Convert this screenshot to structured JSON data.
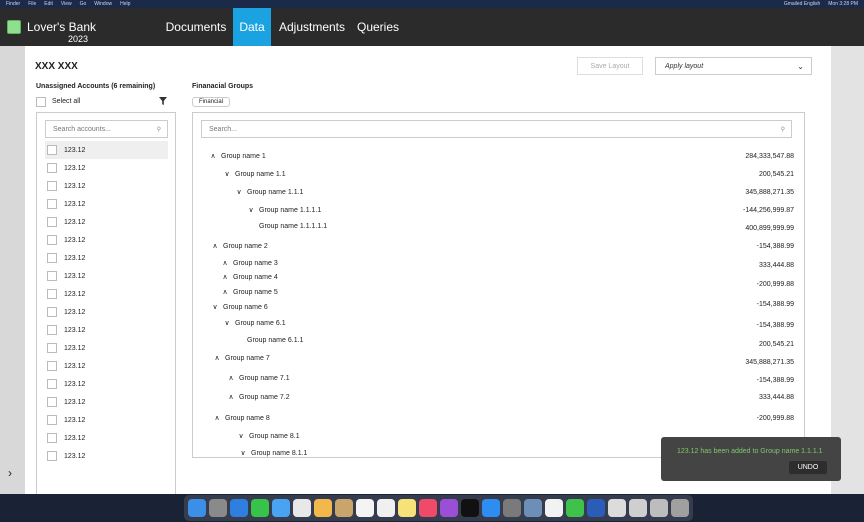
{
  "macbar": {
    "items": [
      "Finder",
      "File",
      "Edit",
      "View",
      "Go",
      "Window",
      "Help"
    ],
    "status_text": "Gmailed English",
    "clock": "Mon 3:28 PM"
  },
  "app": {
    "brand_name": "Lover's Bank",
    "brand_year": "2023",
    "nav": [
      "Documents",
      "Data",
      "Adjustments",
      "Queries"
    ],
    "active_tab": "Data",
    "accent_color": "#1aa3e0"
  },
  "page": {
    "title": "XXX XXX",
    "save_layout_label": "Save Layout",
    "apply_layout_placeholder": "Apply layout"
  },
  "accounts": {
    "title": "Unassigned Accounts (6 remaining)",
    "select_all_label": "Select all",
    "search_placeholder": "Search accounts...",
    "items": [
      "123.12",
      "123.12",
      "123.12",
      "123.12",
      "123.12",
      "123.12",
      "123.12",
      "123.12",
      "123.12",
      "123.12",
      "123.12",
      "123.12",
      "123.12",
      "123.12",
      "123.12",
      "123.12",
      "123.12",
      "123.12"
    ]
  },
  "groups": {
    "title": "Finanacial Groups",
    "tag": "Financial",
    "search_placeholder": "Search...",
    "rows": [
      {
        "name": "Group name 1",
        "value": "284,333,547.88",
        "chevron": "up"
      },
      {
        "name": "Group name 1.1",
        "value": "200,545.21",
        "chevron": "down"
      },
      {
        "name": "Group name 1.1.1",
        "value": "345,888,271.35",
        "chevron": "down"
      },
      {
        "name": "Group name 1.1.1.1",
        "value": "-144,256,999.87",
        "chevron": "down"
      },
      {
        "name": "Group name 1.1.1.1.1",
        "value": "400,899,999.99",
        "chevron": ""
      },
      {
        "name": "Group name 2",
        "value": "-154,388.99",
        "chevron": "up"
      },
      {
        "name": "Group name 3",
        "value": "333,444.88",
        "chevron": "up"
      },
      {
        "name": "Group name 4",
        "value": "-200,999.88",
        "chevron": "up"
      },
      {
        "name": "Group name 5",
        "value": "",
        "chevron": "up"
      },
      {
        "name": "Group name 6",
        "value": "-154,388.99",
        "chevron": "down"
      },
      {
        "name": "Group name 6.1",
        "value": "-154,388.99",
        "chevron": "down"
      },
      {
        "name": "Group name 6.1.1",
        "value": "200,545.21",
        "chevron": ""
      },
      {
        "name": "Group name 7",
        "value": "345,888,271.35",
        "chevron": "up"
      },
      {
        "name": "Group name 7.1",
        "value": "-154,388.99",
        "chevron": "up"
      },
      {
        "name": "Group name 7.2",
        "value": "333,444.88",
        "chevron": "up"
      },
      {
        "name": "Group name 8",
        "value": "-200,999.88",
        "chevron": "up"
      },
      {
        "name": "Group name 8.1",
        "value": "",
        "chevron": "down"
      },
      {
        "name": "Group name 8.1.1",
        "value": "",
        "chevron": "down"
      }
    ]
  },
  "toast": {
    "message": "123.12 has been added to Group name 1.1.1.1",
    "undo_label": "UNDO"
  }
}
